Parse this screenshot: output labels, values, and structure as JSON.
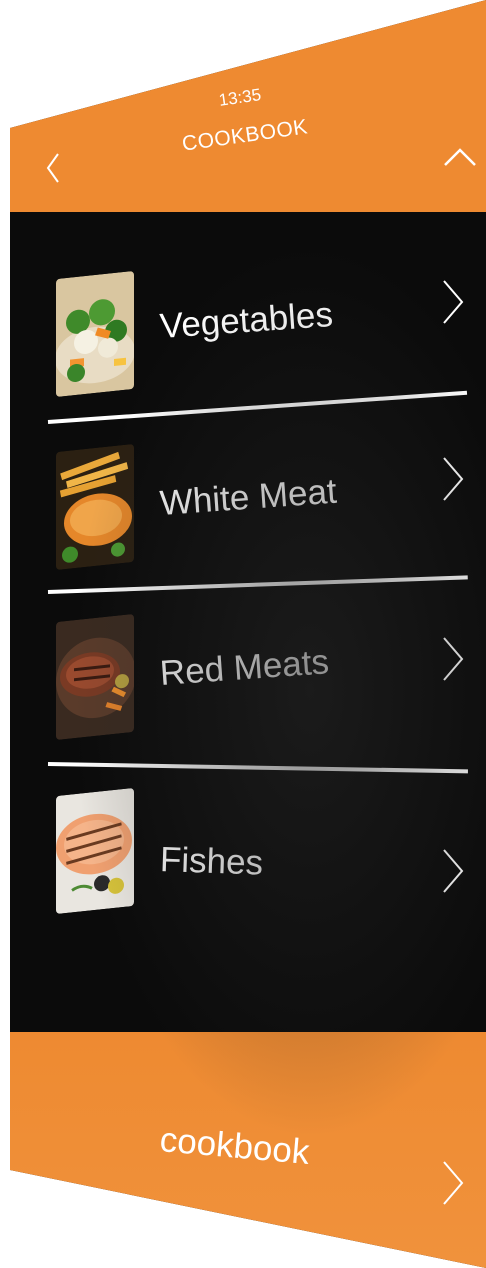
{
  "status_bar": {
    "time": "13:35"
  },
  "header": {
    "title": "COOKBOOK",
    "back_icon": "chevron-left-icon",
    "up_icon": "chevron-up-icon"
  },
  "categories": [
    {
      "label": "Vegetables",
      "image": "vegetables-thumbnail",
      "icon": "chevron-right-icon"
    },
    {
      "label": "White Meat",
      "image": "white-meat-thumbnail",
      "icon": "chevron-right-icon"
    },
    {
      "label": "Red Meats",
      "image": "red-meats-thumbnail",
      "icon": "chevron-right-icon"
    },
    {
      "label": "Fishes",
      "image": "fishes-thumbnail",
      "icon": "chevron-right-icon"
    }
  ],
  "footer": {
    "label": "cookbook",
    "icon": "chevron-right-icon"
  },
  "colors": {
    "accent": "#ee8a31",
    "background": "#0b0b0b",
    "text": "#ffffff"
  }
}
